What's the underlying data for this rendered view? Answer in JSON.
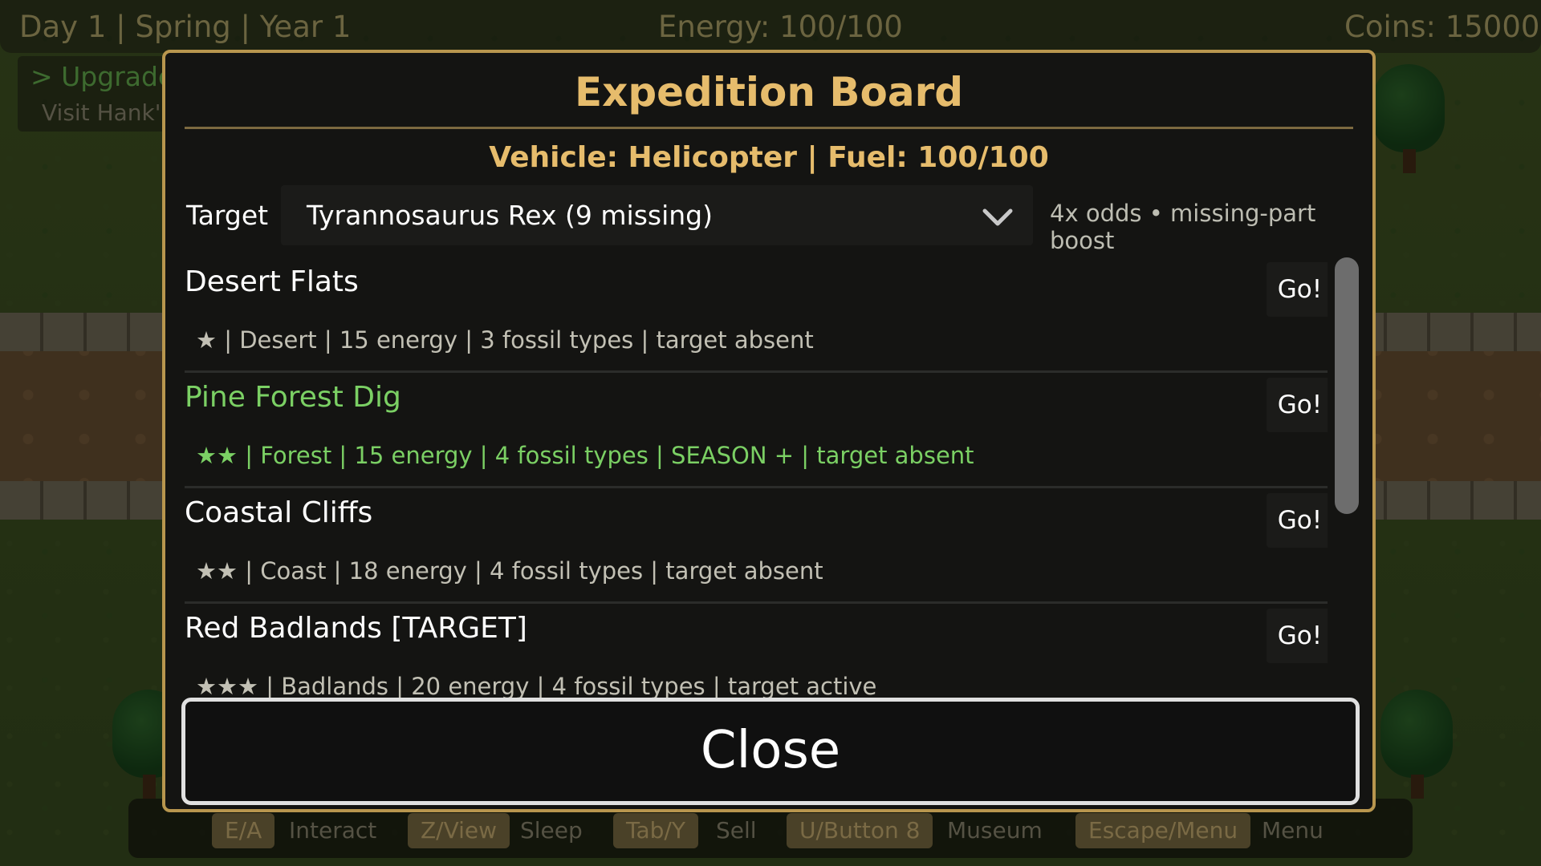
{
  "hud": {
    "date": "Day 1 | Spring | Year 1",
    "energy": "Energy: 100/100",
    "coins": "Coins: 15000",
    "quest_title": "> Upgrade",
    "quest_sub": "Visit Hank'"
  },
  "hotbar": [
    {
      "key": "E/A",
      "action": "Interact"
    },
    {
      "key": "Z/View",
      "action": "Sleep"
    },
    {
      "key": "Tab/Y",
      "action": "Sell"
    },
    {
      "key": "U/Button 8",
      "action": "Museum"
    },
    {
      "key": "Escape/Menu",
      "action": "Menu"
    }
  ],
  "modal": {
    "title": "Expedition Board",
    "vehicle": "Vehicle: Helicopter | Fuel: 100/100",
    "target_label": "Target",
    "target_value": "Tyrannosaurus Rex (9 missing)",
    "odds": "4x odds • missing-part boost",
    "go_label": "Go!",
    "close_label": "Close",
    "scroll_position": 0,
    "expeditions": [
      {
        "name": "Desert Flats",
        "meta": "★ | Desert | 15 energy | 3 fossil types | target absent",
        "highlighted": false
      },
      {
        "name": "Pine Forest Dig",
        "meta": "★★ | Forest | 15 energy | 4 fossil types | SEASON + | target absent",
        "highlighted": true
      },
      {
        "name": "Coastal Cliffs",
        "meta": "★★ | Coast | 18 energy | 4 fossil types | target absent",
        "highlighted": false
      },
      {
        "name": "Red Badlands  [TARGET]",
        "meta": "★★★ | Badlands | 20 energy | 4 fossil types | target active",
        "highlighted": false
      }
    ]
  },
  "colors": {
    "accent_gold": "#e6bc6c",
    "highlight_green": "#7bd064",
    "modal_border": "#b8964e"
  }
}
